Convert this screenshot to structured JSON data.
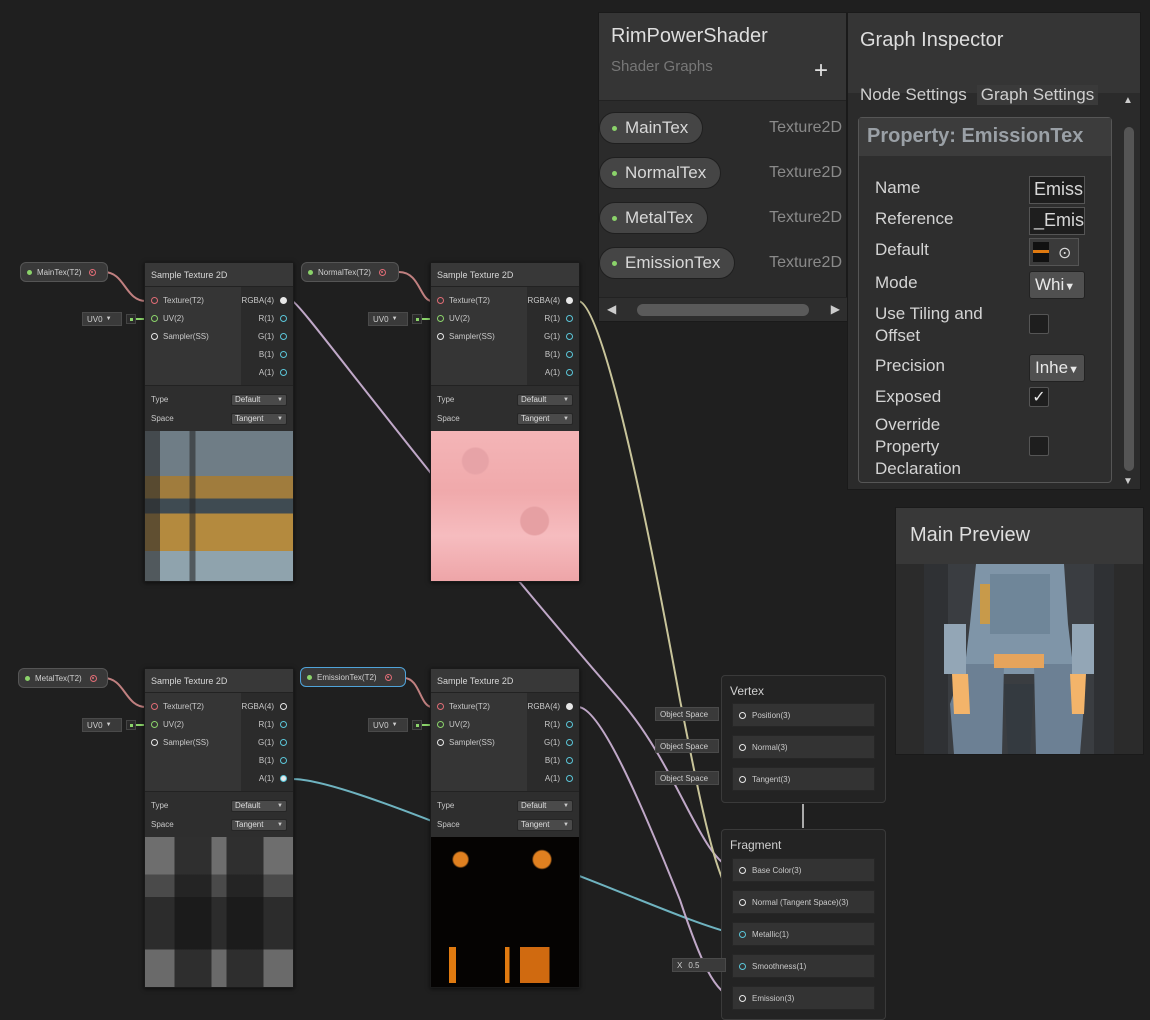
{
  "blackboard": {
    "title": "RimPowerShader",
    "subtitle": "Shader Graphs",
    "add_label": "+",
    "properties": [
      {
        "name": "MainTex",
        "type": "Texture2D"
      },
      {
        "name": "NormalTex",
        "type": "Texture2D"
      },
      {
        "name": "MetalTex",
        "type": "Texture2D"
      },
      {
        "name": "EmissionTex",
        "type": "Texture2D"
      }
    ]
  },
  "inspector": {
    "title": "Graph Inspector",
    "tabs": [
      "Node Settings",
      "Graph Settings"
    ],
    "property_title": "Property: EmissionTex",
    "labels": {
      "name": "Name",
      "reference": "Reference",
      "default": "Default",
      "mode": "Mode",
      "tiling_1": "Use Tiling and",
      "tiling_2": "Offset",
      "precision": "Precision",
      "exposed": "Exposed",
      "override_1": "Override",
      "override_2": "Property",
      "override_3": "Declaration"
    },
    "values": {
      "name": "Emiss",
      "reference": "_Emis",
      "mode": "Whi",
      "precision": "Inhe",
      "exposed_check": "✓"
    }
  },
  "main_preview": {
    "title": "Main Preview"
  },
  "graph": {
    "prop_nodes": [
      "MainTex(T2)",
      "NormalTex(T2)",
      "MetalTex(T2)",
      "EmissionTex(T2)"
    ],
    "uv_label": "UV0",
    "sample_node": {
      "title": "Sample Texture 2D",
      "inputs": [
        "Texture(T2)",
        "UV(2)",
        "Sampler(SS)"
      ],
      "outputs": [
        "RGBA(4)",
        "R(1)",
        "G(1)",
        "B(1)",
        "A(1)"
      ],
      "type_label": "Type",
      "type_value": "Default",
      "space_label": "Space",
      "space_value": "Tangent"
    },
    "vertex": {
      "title": "Vertex",
      "space_tag": "Object Space",
      "blocks": [
        "Position(3)",
        "Normal(3)",
        "Tangent(3)"
      ]
    },
    "fragment": {
      "title": "Fragment",
      "blocks": [
        "Base Color(3)",
        "Normal (Tangent Space)(3)",
        "Metallic(1)",
        "Smoothness(1)",
        "Emission(3)"
      ],
      "smooth_x": "X",
      "smooth_value": "0.5"
    }
  },
  "colors": {
    "background": "#1f1f1f",
    "wire_texture": "#c09090",
    "wire_vector4": "#c9a9c9",
    "wire_normal": "#c8c49a",
    "wire_float": "#6fb3c0",
    "selection": "#4fa3d9"
  }
}
